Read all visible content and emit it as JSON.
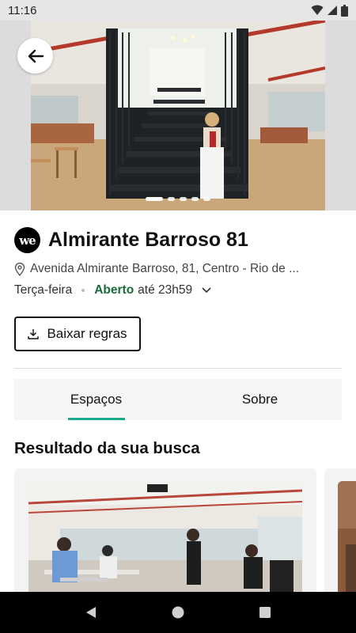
{
  "status_bar": {
    "time": "11:16"
  },
  "hero": {
    "page_count": 5,
    "active_page": 0
  },
  "location": {
    "logo_text": "we",
    "title": "Almirante Barroso 81",
    "address": "Avenida Almirante Barroso, 81, Centro - Rio de ...",
    "day": "Terça-feira",
    "status": "Aberto",
    "until": "até 23h59"
  },
  "actions": {
    "download_label": "Baixar regras"
  },
  "tabs": [
    {
      "label": "Espaços",
      "active": true
    },
    {
      "label": "Sobre",
      "active": false
    }
  ],
  "results": {
    "title": "Resultado da sua busca"
  },
  "colors": {
    "accent": "#1ca88a",
    "open_status": "#1a6b3a"
  }
}
